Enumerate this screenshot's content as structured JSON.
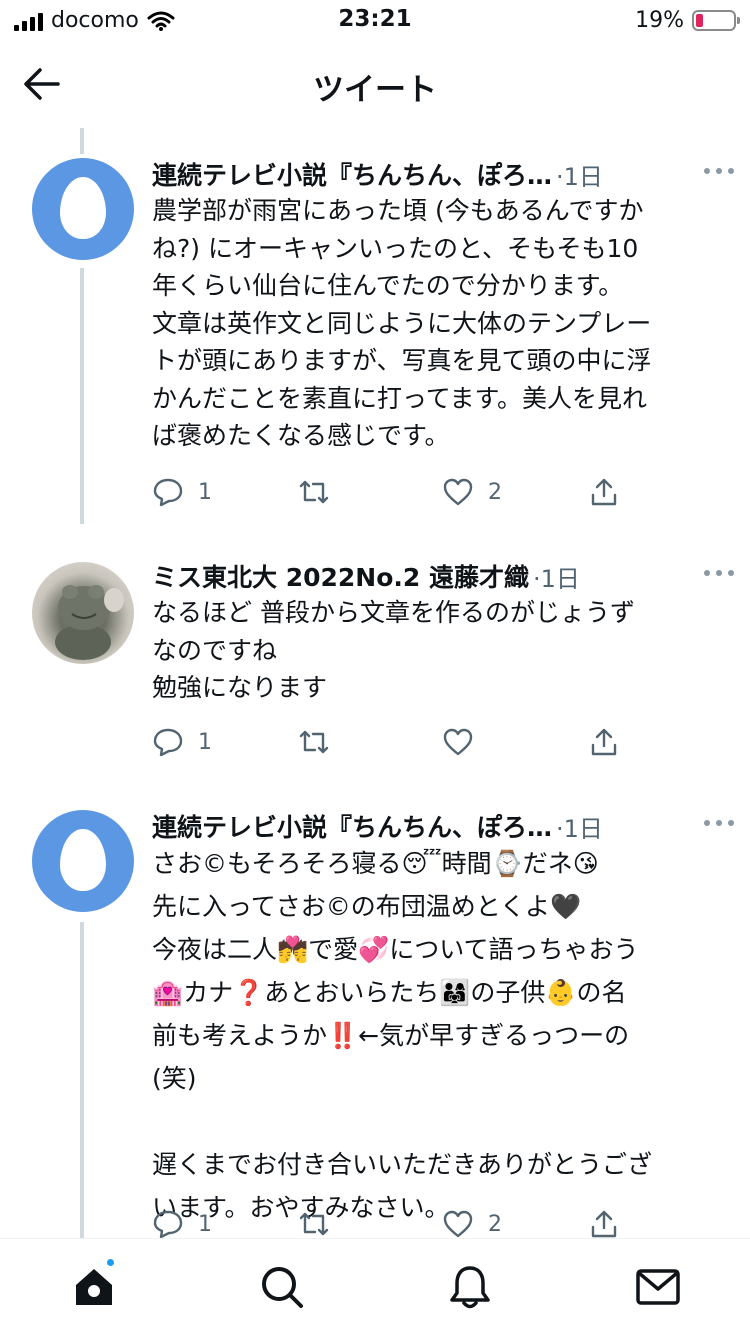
{
  "status_bar": {
    "carrier": "docomo",
    "time": "23:21",
    "battery_percent": "19%",
    "battery_level": 0.19
  },
  "header": {
    "title": "ツイート",
    "back_icon": "arrow-left-icon"
  },
  "tweets": [
    {
      "name": "連続テレビ小説『ちんちん、ぽろ…",
      "time": "·1日",
      "text": "農学部が雨宮にあった頃 (今もあるんですか\nね?) にオーキャンいったのと、そもそも10\n年くらい仙台に住んでたので分かります。\n文章は英作文と同じように大体のテンプレー\nトが頭にありますが、写真を見て頭の中に浮\nかんだことを素直に打ってます。美人を見れ\nば褒めたくなる感じです。",
      "replies": "1",
      "retweets": "",
      "likes": "2"
    },
    {
      "name": "ミス東北大 2022No.2 遠藤才織",
      "time": "·1日",
      "text": "なるほど 普段から文章を作るのがじょうず\nなのですね\n勉強になります",
      "replies": "1",
      "retweets": "",
      "likes": ""
    },
    {
      "name": "連続テレビ小説『ちんちん、ぽろ…",
      "time": "·1日",
      "text": "さお©もそろそろ寝る😴時間⌚だネ😘\n先に入ってさお©の布団温めとくよ🖤\n今夜は二人💏で愛💞について語っちゃおう\n🏩カナ❓あとおいらたち👨‍👩‍👧の子供👶の名\n前も考えようか‼️←気が早すぎるっつーの\n(笑)\n\n遅くまでお付き合いいただきありがとうござ\nいます。おやすみなさい。",
      "replies": "1",
      "retweets": "",
      "likes": "2"
    }
  ],
  "bottom_nav": {
    "items": [
      "home-icon",
      "search-icon",
      "notifications-icon",
      "messages-icon"
    ]
  },
  "colors": {
    "accent": "#1d9bf0",
    "secondary_text": "#536471",
    "egg_avatar": "#5b97e3",
    "battery_low": "#e0245e"
  }
}
